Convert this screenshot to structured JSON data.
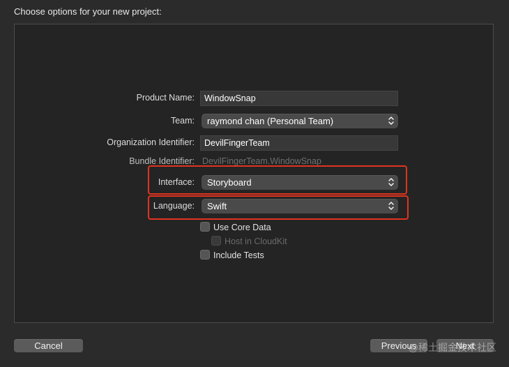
{
  "dialog": {
    "heading": "Choose options for your new project:"
  },
  "form": {
    "product_name": {
      "label": "Product Name:",
      "value": "WindowSnap"
    },
    "team": {
      "label": "Team:",
      "value": "raymond chan (Personal Team)"
    },
    "organization_identifier": {
      "label": "Organization Identifier:",
      "value": "DevilFingerTeam"
    },
    "bundle_identifier": {
      "label": "Bundle Identifier:",
      "value": "DevilFingerTeam.WindowSnap"
    },
    "interface": {
      "label": "Interface:",
      "value": "Storyboard"
    },
    "language": {
      "label": "Language:",
      "value": "Swift"
    },
    "use_core_data": {
      "label": "Use Core Data",
      "checked": false
    },
    "host_in_cloudkit": {
      "label": "Host in CloudKit",
      "checked": false,
      "disabled": true
    },
    "include_tests": {
      "label": "Include Tests",
      "checked": false
    }
  },
  "buttons": {
    "cancel": "Cancel",
    "previous": "Previous",
    "next": "Next"
  },
  "watermark": "@稀土掘金技术社区",
  "colors": {
    "highlight": "#e0341f",
    "background": "#2b2b2b",
    "panel": "#242424"
  },
  "icons": {
    "popup_indicator": "chevron-up-down-icon"
  }
}
